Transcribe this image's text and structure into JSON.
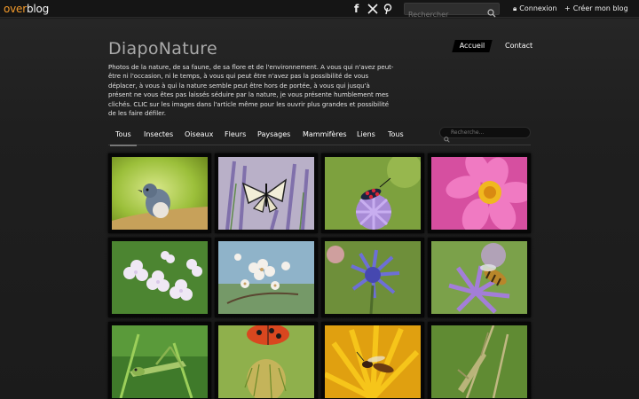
{
  "topbar": {
    "logo_part1": "over",
    "logo_part2": "blog",
    "search_placeholder": "Rechercher",
    "login_label": "Connexion",
    "create_label": "Créer mon blog"
  },
  "header": {
    "title": "DiapoNature",
    "nav": [
      "Accueil",
      "Contact"
    ],
    "description": "Photos de la nature, de sa faune, de sa flore et de l'environnement. A vous qui n'avez peut- être ni l'occasion, ni le temps, à vous qui peut être n'avez pas la possibilité de vous déplacer, à vous à qui la nature semble peut être hors de portée, à vous qui jusqu'à présent ne vous êtes pas laissés séduire par la nature, je vous présente humblement mes clichés. CLIC sur les images dans l'article même pour les ouvrir plus grandes et possibilité de les faire défiler."
  },
  "categories": [
    "Tous",
    "Insectes",
    "Oiseaux",
    "Fleurs",
    "Paysages",
    "Mammifères",
    "Liens",
    "Tous"
  ],
  "gallery_search_placeholder": "Recherche...",
  "gallery": [
    "bird-photo",
    "swallowtail-butterfly-photo",
    "burnet-moth-photo",
    "pink-cosmos-photo",
    "white-flowers-photo",
    "blossom-photo",
    "cornflower-photo",
    "bee-on-cornflower-photo",
    "grasshopper-photo",
    "ladybird-photo",
    "wasp-on-yellow-flower-photo",
    "green-cricket-photo"
  ],
  "colors": {
    "accent": "#f39a2b",
    "background": "#1c1c1c"
  }
}
